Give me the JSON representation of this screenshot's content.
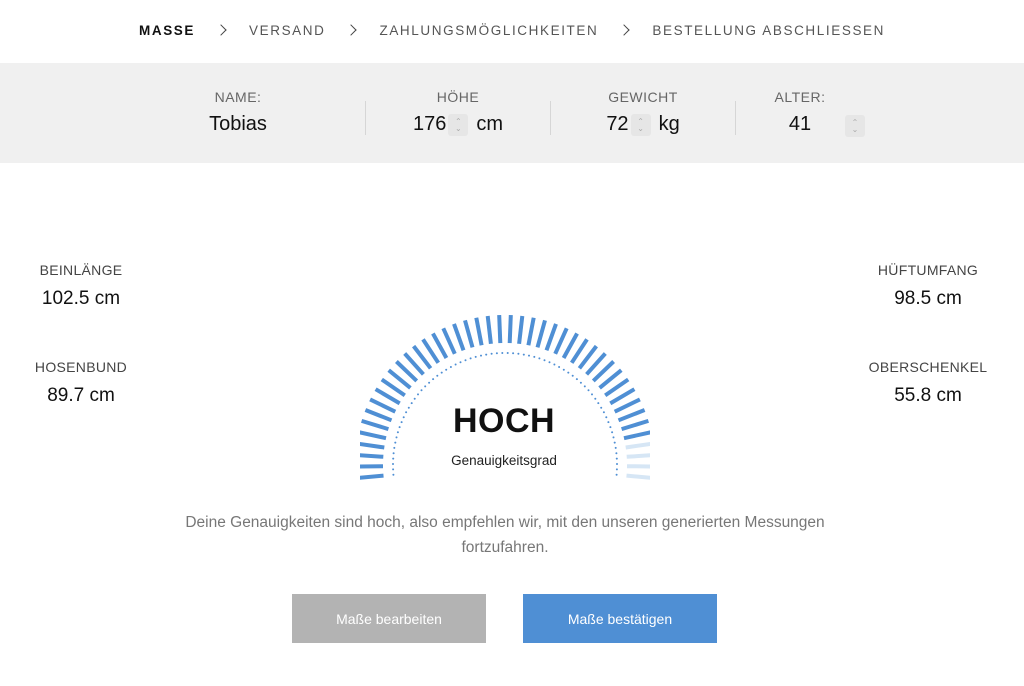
{
  "breadcrumb": {
    "steps": [
      "MASSE",
      "VERSAND",
      "ZAHLUNGSMÖGLICHKEITEN",
      "BESTELLUNG ABSCHLIESSEN"
    ],
    "active_index": 0
  },
  "profile": {
    "name_label": "NAME:",
    "name_value": "Tobias",
    "height_label": "HÖHE",
    "height_value": "176",
    "height_unit": "cm",
    "weight_label": "GEWICHT",
    "weight_value": "72",
    "weight_unit": "kg",
    "age_label": "ALTER:",
    "age_value": "41"
  },
  "measurements": {
    "leg_length": {
      "label": "BEINLÄNGE",
      "value": "102.5 cm"
    },
    "waistband": {
      "label": "HOSENBUND",
      "value": "89.7 cm"
    },
    "hip": {
      "label": "HÜFTUMFANG",
      "value": "98.5 cm"
    },
    "thigh": {
      "label": "OBERSCHENKEL",
      "value": "55.8 cm"
    }
  },
  "accuracy": {
    "level": "HOCH",
    "caption": "Genauigkeitsgrad",
    "fill_fraction": 0.9,
    "accent_color": "#4f8fd4",
    "inactive_color": "#d6e6f5"
  },
  "message": "Deine Genauigkeiten sind hoch, also empfehlen wir, mit den unseren generierten Messungen fortzufahren.",
  "buttons": {
    "edit_label": "Maße bearbeiten",
    "confirm_label": "Maße bestätigen"
  }
}
